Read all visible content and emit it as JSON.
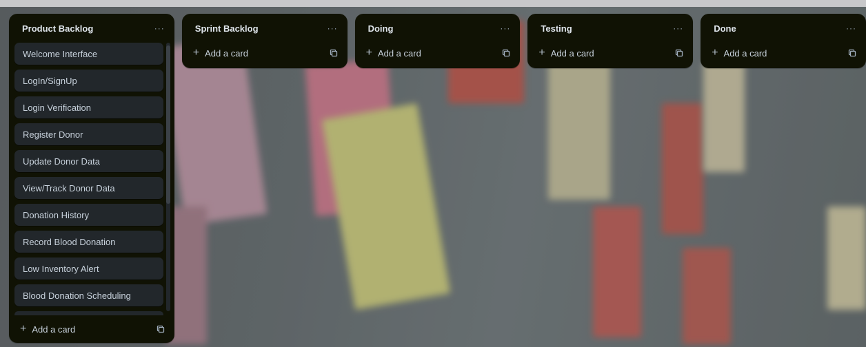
{
  "lists": [
    {
      "title": "Product Backlog",
      "menu": "···",
      "cards": [
        "Welcome Interface",
        "LogIn/SignUp",
        "Login Verification",
        "Register Donor",
        "Update Donor Data",
        "View/Track Donor Data",
        "Donation History",
        "Record Blood Donation",
        "Low Inventory Alert",
        "Blood Donation Scheduling"
      ],
      "add_label": "Add a card"
    },
    {
      "title": "Sprint Backlog",
      "menu": "···",
      "add_label": "Add a card"
    },
    {
      "title": "Doing",
      "menu": "···",
      "add_label": "Add a card"
    },
    {
      "title": "Testing",
      "menu": "···",
      "add_label": "Add a card"
    },
    {
      "title": "Done",
      "menu": "···",
      "add_label": "Add a card"
    }
  ],
  "icons": {
    "add": "plus-icon",
    "template": "card-template-icon",
    "menu": "more-options-icon"
  },
  "colors": {
    "list_bg": "#101204",
    "card_bg": "#22272b",
    "text": "#c7d1db"
  }
}
